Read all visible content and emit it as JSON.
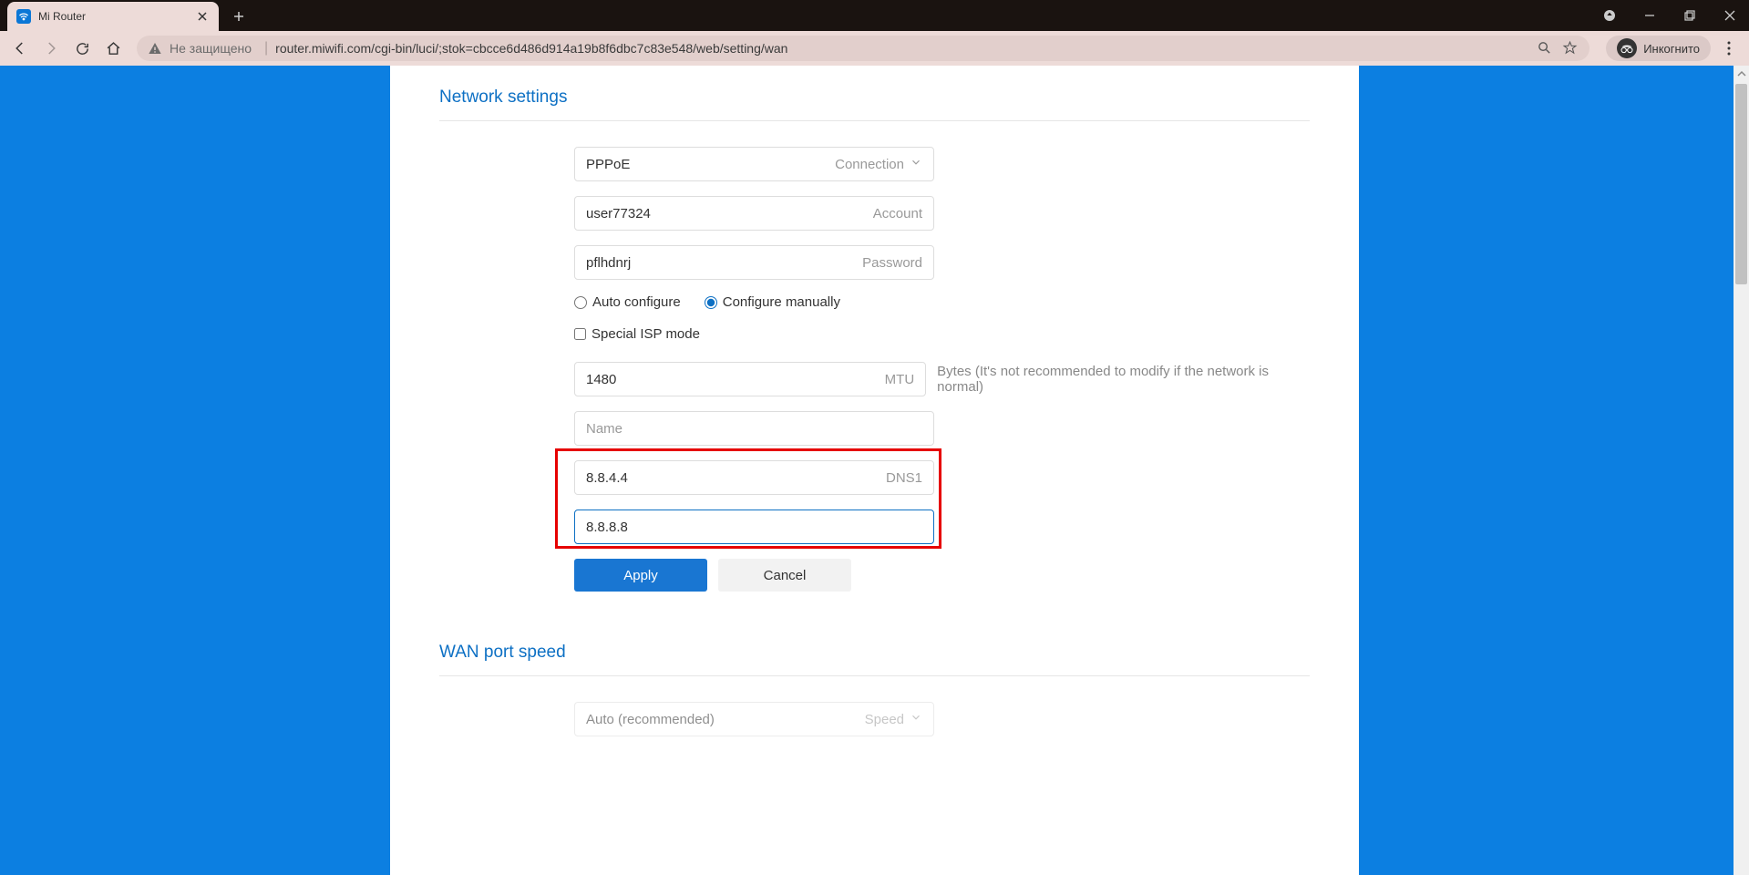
{
  "browser": {
    "tab_title": "Mi Router",
    "not_secure": "Не защищено",
    "url": "router.miwifi.com/cgi-bin/luci/;stok=cbcce6d486d914a19b8f6dbc7c83e548/web/setting/wan",
    "incognito_label": "Инкогнито"
  },
  "network_settings": {
    "title": "Network settings",
    "connection": {
      "value": "PPPoE",
      "label": "Connection"
    },
    "account": {
      "value": "user77324",
      "label": "Account"
    },
    "password": {
      "value": "pflhdnrj",
      "label": "Password"
    },
    "config_mode": {
      "auto": "Auto configure",
      "manual": "Configure manually",
      "selected": "manual"
    },
    "special_isp": {
      "label": "Special ISP mode",
      "checked": false
    },
    "mtu": {
      "value": "1480",
      "label": "MTU",
      "hint": "Bytes (It's not recommended to modify if the network is normal)"
    },
    "name": {
      "placeholder": "Name"
    },
    "dns1": {
      "value": "8.8.4.4",
      "label": "DNS1"
    },
    "dns2": {
      "value": "8.8.8.8"
    },
    "apply": "Apply",
    "cancel": "Cancel"
  },
  "wan_port_speed": {
    "title": "WAN port speed",
    "speed": {
      "value": "Auto (recommended)",
      "label": "Speed"
    }
  }
}
